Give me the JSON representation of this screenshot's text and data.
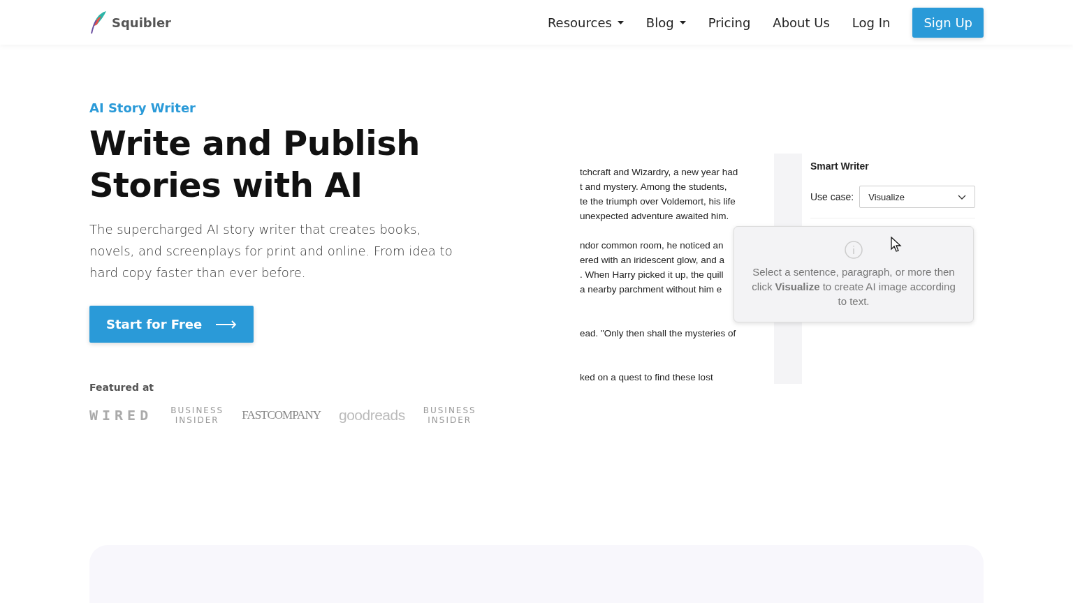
{
  "header": {
    "logo": "Squibler",
    "nav": [
      {
        "label": "Resources",
        "dropdown": true
      },
      {
        "label": "Blog",
        "dropdown": true
      },
      {
        "label": "Pricing",
        "dropdown": false
      },
      {
        "label": "About Us",
        "dropdown": false
      },
      {
        "label": "Log In",
        "dropdown": false
      }
    ],
    "signup": "Sign Up"
  },
  "hero": {
    "eyebrow": "AI Story Writer",
    "title_lines": [
      "Write and Publish",
      "Stories with AI"
    ],
    "description": "The supercharged AI story writer that creates books, novels, and screenplays for print and online. From idea to hard copy faster than ever before.",
    "cta": "Start for Free",
    "featured_label": "Featured at",
    "logos": [
      {
        "kind": "boxed",
        "text": "WIRED"
      },
      {
        "kind": "stacked",
        "lines": [
          "BUSINESS",
          "INSIDER"
        ]
      },
      {
        "kind": "serif",
        "text": "FASTCOMPANY"
      },
      {
        "kind": "light",
        "text": "goodreads"
      },
      {
        "kind": "stacked",
        "lines": [
          "BUSINESS",
          "INSIDER"
        ]
      }
    ]
  },
  "demo": {
    "document_paragraphs": [
      [
        "tchcraft and Wizardry, a new year had",
        "t and mystery. Among the students,",
        "te the triumph over Voldemort, his life",
        "unexpected adventure awaited him."
      ],
      [
        "ndor common room, he noticed an",
        "ered with an iridescent glow, and a",
        ". When Harry picked it up, the quill",
        "a nearby parchment without him e"
      ],
      [
        "ead. \"Only then shall the mysteries of"
      ],
      [
        "ked on a quest to find these lost"
      ]
    ],
    "panel_title": "Smart Writer",
    "use_case_label": "Use case:",
    "use_case_value": "Visualize",
    "tooltip": "Select a sentence, paragraph, or more then click **Visualize** to create AI image according to text."
  }
}
